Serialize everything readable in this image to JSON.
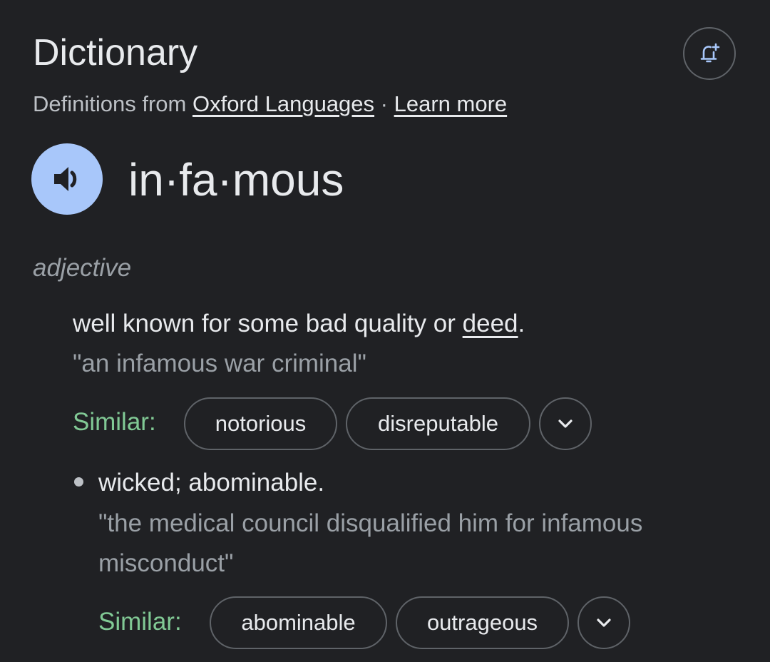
{
  "header": {
    "title": "Dictionary",
    "alert_icon": "bell-plus-icon"
  },
  "source": {
    "prefix": "Definitions from ",
    "provider_link": "Oxford Languages",
    "separator": " · ",
    "learn_more": "Learn more"
  },
  "entry": {
    "speak_icon": "speaker-icon",
    "headword": "in·fa·mous",
    "part_of_speech": "adjective"
  },
  "senses": [
    {
      "definition_before": "well known for some bad quality or ",
      "definition_link": "deed",
      "definition_after": ".",
      "example": "\"an infamous war criminal\"",
      "similar_label": "Similar:",
      "similar": [
        "notorious",
        "disreputable"
      ],
      "expand_icon": "chevron-down-icon"
    },
    {
      "definition": "wicked; abominable.",
      "example": "\"the medical council disqualified him for infamous misconduct\"",
      "similar_label": "Similar:",
      "similar": [
        "abominable",
        "outrageous"
      ],
      "expand_icon": "chevron-down-icon"
    }
  ],
  "colors": {
    "background": "#202124",
    "text": "#e8eaed",
    "muted": "#9aa0a6",
    "accent_blue": "#a8c7fa",
    "similar_green": "#81c995",
    "chip_border": "#5f6368"
  }
}
